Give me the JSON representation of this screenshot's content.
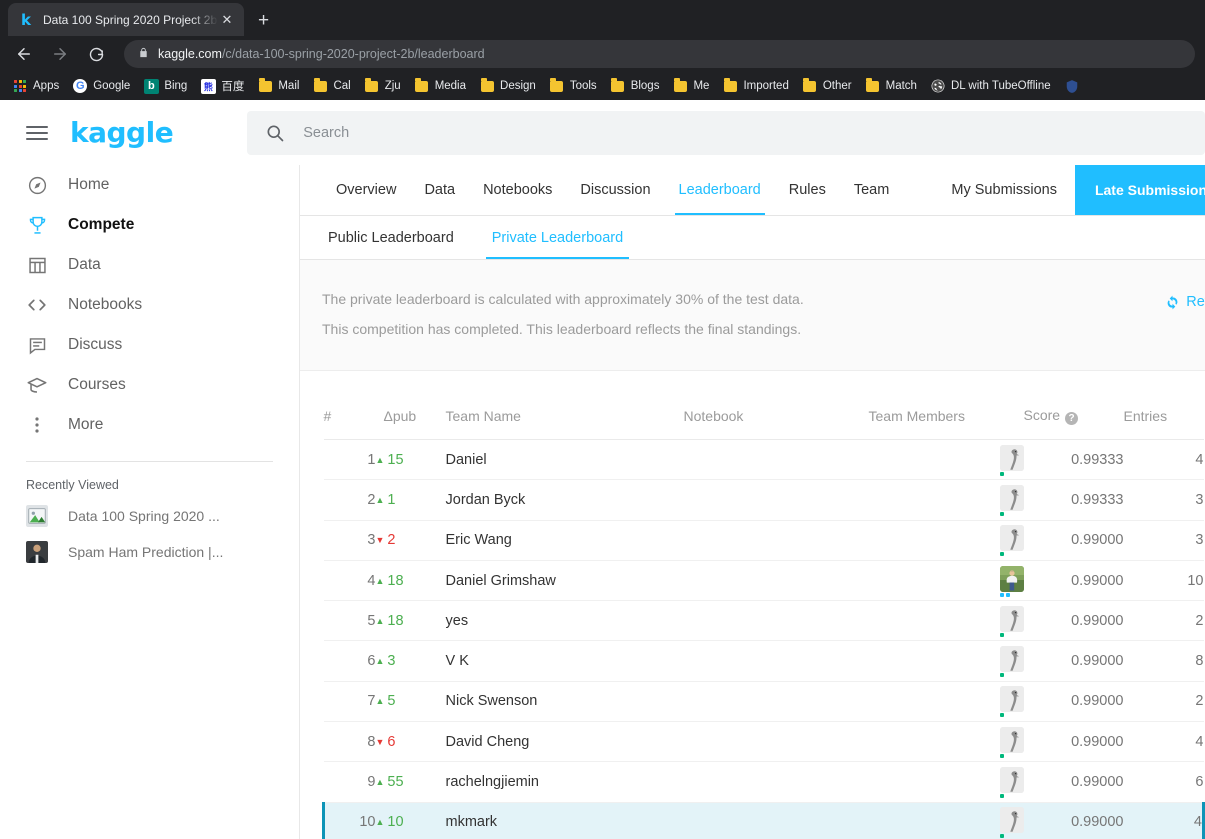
{
  "browser": {
    "tab": {
      "title": "Data 100 Spring 2020 Project 2b",
      "favicon": "kaggle-favicon",
      "close_label": "✕"
    },
    "new_tab_label": "+",
    "back_label": "←",
    "forward_label": "→",
    "reload_label": "⟳",
    "lock_label": "🔒",
    "url_domain": "kaggle.com",
    "url_path": "/c/data-100-spring-2020-project-2b/leaderboard",
    "bookmarks": [
      {
        "label": "Apps",
        "icon": "apps-grid-icon"
      },
      {
        "label": "Google",
        "icon": "google-icon"
      },
      {
        "label": "Bing",
        "icon": "bing-icon"
      },
      {
        "label": "百度",
        "icon": "baidu-icon"
      },
      {
        "label": "Mail",
        "icon": "folder-icon"
      },
      {
        "label": "Cal",
        "icon": "folder-icon"
      },
      {
        "label": "Zju",
        "icon": "folder-icon"
      },
      {
        "label": "Media",
        "icon": "folder-icon"
      },
      {
        "label": "Design",
        "icon": "folder-icon"
      },
      {
        "label": "Tools",
        "icon": "folder-icon"
      },
      {
        "label": "Blogs",
        "icon": "folder-icon"
      },
      {
        "label": "Me",
        "icon": "folder-icon"
      },
      {
        "label": "Imported",
        "icon": "folder-icon"
      },
      {
        "label": "Other",
        "icon": "folder-icon"
      },
      {
        "label": "Match",
        "icon": "folder-icon"
      },
      {
        "label": "DL with TubeOffline",
        "icon": "globe-icon"
      },
      {
        "label": "",
        "icon": "shield-icon"
      }
    ]
  },
  "header": {
    "menu_label": "menu",
    "logo": "kaggle",
    "search_placeholder": "Search"
  },
  "sidebar": {
    "items": [
      {
        "label": "Home",
        "icon": "compass-icon",
        "active": false
      },
      {
        "label": "Compete",
        "icon": "trophy-icon",
        "active": true
      },
      {
        "label": "Data",
        "icon": "table-icon",
        "active": false
      },
      {
        "label": "Notebooks",
        "icon": "code-icon",
        "active": false
      },
      {
        "label": "Discuss",
        "icon": "comment-icon",
        "active": false
      },
      {
        "label": "Courses",
        "icon": "graduation-cap-icon",
        "active": false
      },
      {
        "label": "More",
        "icon": "kebab-menu-icon",
        "active": false
      }
    ],
    "recently_viewed_label": "Recently Viewed",
    "recently_viewed": [
      {
        "label": "Data 100 Spring 2020 ...",
        "icon": "competition-thumb"
      },
      {
        "label": "Spam Ham Prediction |...",
        "icon": "notebook-thumb"
      }
    ]
  },
  "competition_nav": {
    "tabs": [
      {
        "label": "Overview",
        "active": false
      },
      {
        "label": "Data",
        "active": false
      },
      {
        "label": "Notebooks",
        "active": false
      },
      {
        "label": "Discussion",
        "active": false
      },
      {
        "label": "Leaderboard",
        "active": true
      },
      {
        "label": "Rules",
        "active": false
      },
      {
        "label": "Team",
        "active": false
      }
    ],
    "my_submissions": "My Submissions",
    "cta": "Late Submission"
  },
  "leaderboard": {
    "tabs": [
      {
        "label": "Public Leaderboard",
        "active": false
      },
      {
        "label": "Private Leaderboard",
        "active": true
      }
    ],
    "note_line1": "The private leaderboard is calculated with approximately 30% of the test data.",
    "note_line2": "This competition has completed. This leaderboard reflects the final standings.",
    "refresh_label": "Refresh",
    "refresh_icon": "refresh-icon",
    "columns": {
      "rank": "#",
      "delta": "Δpub",
      "team_name": "Team Name",
      "notebook": "Notebook",
      "team_members": "Team Members",
      "score": "Score",
      "entries": "Entries"
    },
    "score_help_badge": "?",
    "rows": [
      {
        "rank": "1",
        "delta": "15",
        "delta_dir": "up",
        "team": "Daniel",
        "notebook": "",
        "avatar": "goose-avatar",
        "tier": [
          "#00b87c"
        ],
        "score": "0.99333",
        "entries": "4",
        "highlight": false
      },
      {
        "rank": "2",
        "delta": "1",
        "delta_dir": "up",
        "team": "Jordan Byck",
        "notebook": "",
        "avatar": "goose-avatar",
        "tier": [
          "#00b87c"
        ],
        "score": "0.99333",
        "entries": "3",
        "highlight": false
      },
      {
        "rank": "3",
        "delta": "2",
        "delta_dir": "down",
        "team": "Eric Wang",
        "notebook": "",
        "avatar": "goose-avatar",
        "tier": [
          "#00b87c"
        ],
        "score": "0.99000",
        "entries": "3",
        "highlight": false
      },
      {
        "rank": "4",
        "delta": "18",
        "delta_dir": "up",
        "team": "Daniel Grimshaw",
        "notebook": "",
        "avatar": "person-avatar",
        "tier": [
          "#20beff",
          "#20beff"
        ],
        "score": "0.99000",
        "entries": "10",
        "highlight": false
      },
      {
        "rank": "5",
        "delta": "18",
        "delta_dir": "up",
        "team": "yes",
        "notebook": "",
        "avatar": "goose-avatar",
        "tier": [
          "#00b87c"
        ],
        "score": "0.99000",
        "entries": "2",
        "highlight": false
      },
      {
        "rank": "6",
        "delta": "3",
        "delta_dir": "up",
        "team": "V K",
        "notebook": "",
        "avatar": "goose-avatar",
        "tier": [
          "#00b87c"
        ],
        "score": "0.99000",
        "entries": "8",
        "highlight": false
      },
      {
        "rank": "7",
        "delta": "5",
        "delta_dir": "up",
        "team": "Nick Swenson",
        "notebook": "",
        "avatar": "goose-avatar",
        "tier": [
          "#00b87c"
        ],
        "score": "0.99000",
        "entries": "2",
        "highlight": false
      },
      {
        "rank": "8",
        "delta": "6",
        "delta_dir": "down",
        "team": "David Cheng",
        "notebook": "",
        "avatar": "goose-avatar",
        "tier": [
          "#00b87c"
        ],
        "score": "0.99000",
        "entries": "4",
        "highlight": false
      },
      {
        "rank": "9",
        "delta": "55",
        "delta_dir": "up",
        "team": "rachelngjiemin",
        "notebook": "",
        "avatar": "goose-avatar",
        "tier": [
          "#00b87c"
        ],
        "score": "0.99000",
        "entries": "6",
        "highlight": false
      },
      {
        "rank": "10",
        "delta": "10",
        "delta_dir": "up",
        "team": "mkmark",
        "notebook": "",
        "avatar": "goose-avatar",
        "tier": [
          "#00b87c"
        ],
        "score": "0.99000",
        "entries": "4",
        "highlight": true
      }
    ]
  },
  "colors": {
    "kaggle_blue": "#20beff",
    "up_green": "#4caf50",
    "down_red": "#e53935",
    "highlight_bg": "#e3f3f8",
    "highlight_border": "#0d94b7"
  }
}
